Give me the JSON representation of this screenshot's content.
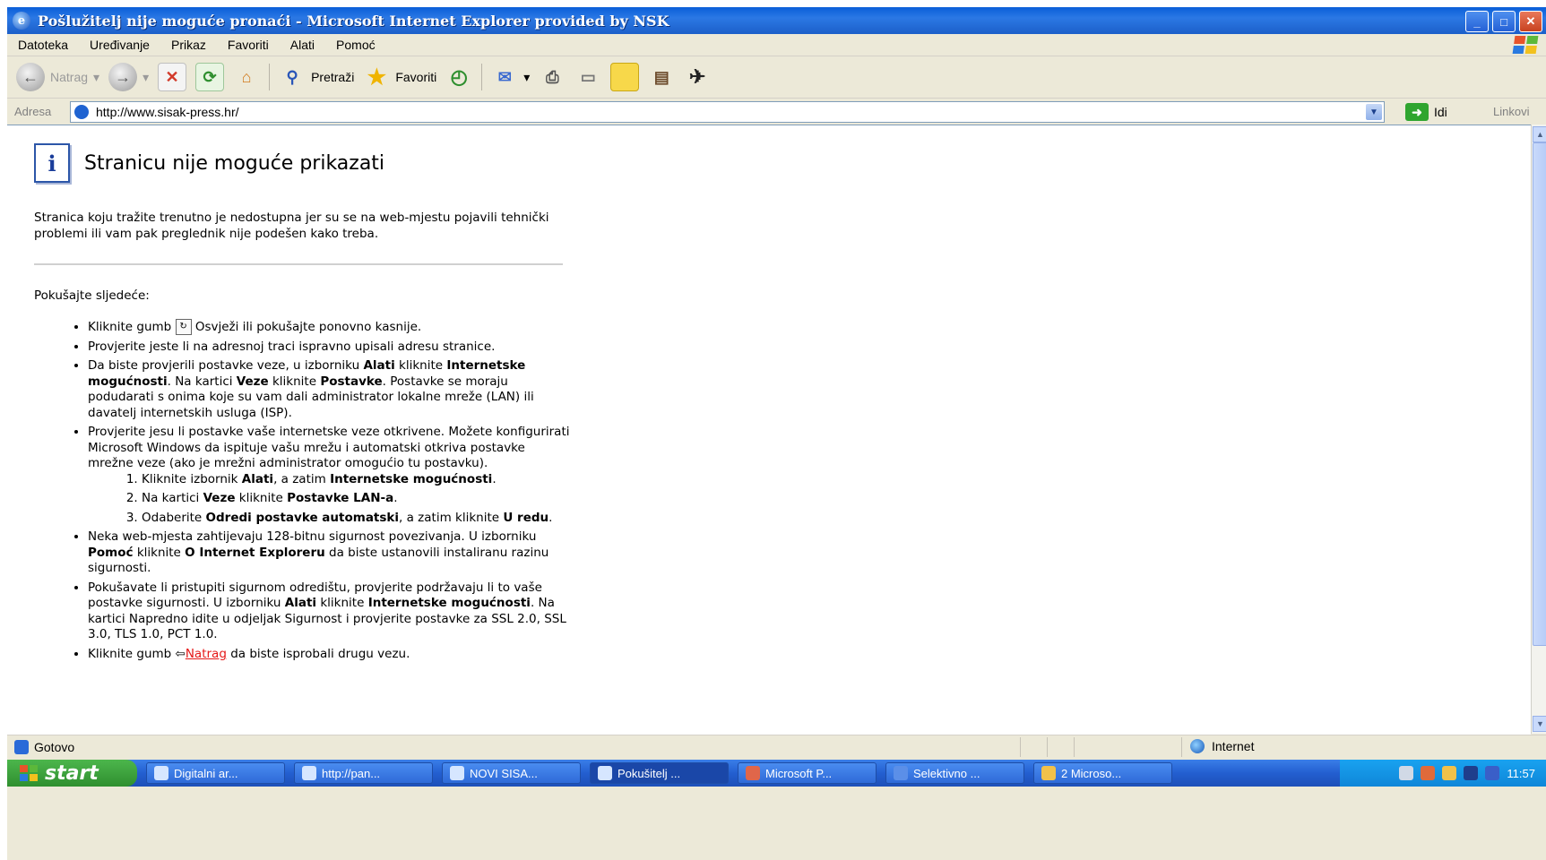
{
  "window": {
    "title": "Pošlužitelj nije moguće pronaći - Microsoft Internet Explorer provided by NSK",
    "app_icon_letter": "e"
  },
  "menu": [
    "Datoteka",
    "Uređivanje",
    "Prikaz",
    "Favoriti",
    "Alati",
    "Pomoć"
  ],
  "toolbar": {
    "back_label": "Natrag",
    "search_label": "Pretraži",
    "favorites_label": "Favoriti"
  },
  "address": {
    "label": "Adresa",
    "url": "http://www.sisak-press.hr/",
    "go_label": "Idi",
    "links_label": "Linkovi"
  },
  "page": {
    "heading": "Stranicu nije moguće prikazati",
    "intro": "Stranica koju tražite trenutno je nedostupna jer su se na web-mjestu pojavili tehnički problemi ili vam pak preglednik nije podešen kako treba.",
    "try_label": "Pokušajte sljedeće:",
    "tip1_a": "Kliknite gumb",
    "tip1_b": "Osvježi ili pokušajte ponovno kasnije.",
    "tip2": "Provjerite jeste li na adresnoj traci ispravno upisali adresu stranice.",
    "tip3_a": "Da biste provjerili postavke veze, u izborniku",
    "tip3_b": "Alati",
    "tip3_c": "kliknite",
    "tip3_d": "Internetske mogućnosti",
    "tip3_e": ". Na kartici",
    "tip3_f": "Veze",
    "tip3_g": "kliknite",
    "tip3_h": "Postavke",
    "tip3_i": ". Postavke se moraju podudarati s onima koje su vam dali administrator lokalne mreže (LAN) ili davatelj internetskih usluga (ISP).",
    "tip4": "Provjerite jesu li postavke vaše internetske veze otkrivene. Možete konfigurirati Microsoft Windows da ispituje vašu mrežu i automatski otkriva postavke mrežne veze (ako je mrežni administrator omogućio tu postavku).",
    "step1_a": "Kliknite izbornik",
    "step1_b": "Alati",
    "step1_c": ", a zatim",
    "step1_d": "Internetske mogućnosti",
    "step1_e": ".",
    "step2_a": "Na kartici",
    "step2_b": "Veze",
    "step2_c": "kliknite",
    "step2_d": "Postavke LAN-a",
    "step2_e": ".",
    "step3_a": "Odaberite",
    "step3_b": "Odredi postavke automatski",
    "step3_c": ", a zatim kliknite",
    "step3_d": "U redu",
    "step3_e": ".",
    "tip5_a": "Neka web-mjesta zahtijevaju 128-bitnu sigurnost povezivanja. U izborniku",
    "tip5_b": "Pomoć",
    "tip5_c": "kliknite",
    "tip5_d": "O Internet Exploreru",
    "tip5_e": "da biste ustanovili instaliranu razinu sigurnosti.",
    "tip6_a": "Pokušavate li pristupiti sigurnom odredištu, provjerite podržavaju li to vaše postavke sigurnosti. U izborniku",
    "tip6_b": "Alati",
    "tip6_c": "kliknite",
    "tip6_d": "Internetske mogućnosti",
    "tip6_e": ". Na kartici Napredno idite u odjeljak Sigurnost i provjerite postavke za SSL 2.0, SSL 3.0, TLS 1.0, PCT 1.0.",
    "tip7_a": "Kliknite gumb",
    "tip7_link": "Natrag",
    "tip7_b": "da biste isprobali drugu vezu."
  },
  "status": {
    "left": "Gotovo",
    "zone": "Internet"
  },
  "taskbar": {
    "start_label": "start",
    "items": [
      "Digitalni ar...",
      "http://pan...",
      "NOVI SISA...",
      "Pokušitelj ...",
      "Microsoft P...",
      "Selektivno ...",
      "2 Microso..."
    ],
    "clock": "11:57"
  },
  "colors": {
    "title_blue": "#2b78e4",
    "chrome_bg": "#ece9d8",
    "link_red": "#e51818",
    "start_green": "#3a9f3a"
  }
}
